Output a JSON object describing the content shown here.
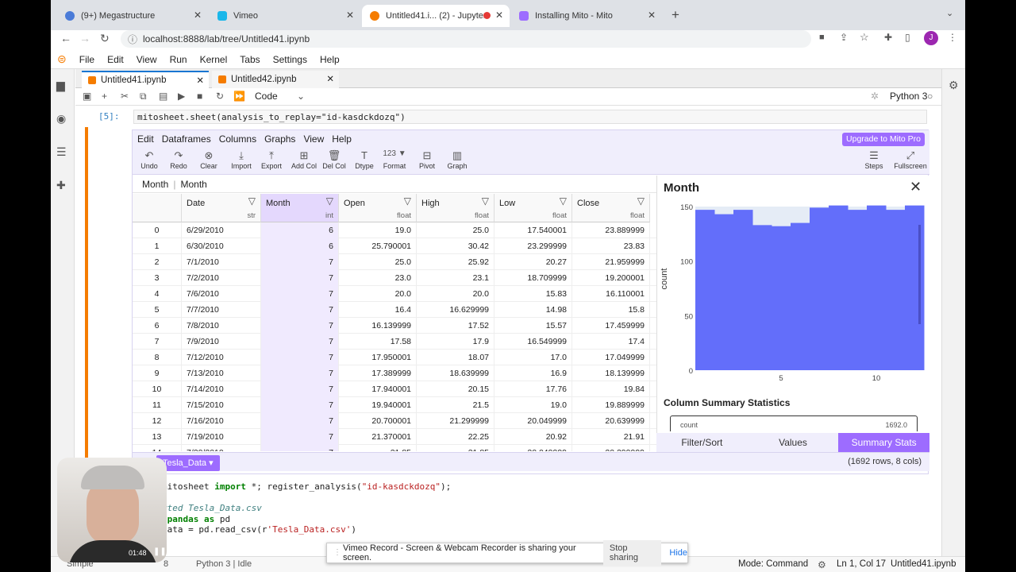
{
  "browser": {
    "tabs": [
      {
        "title": "(9+) Megastructure",
        "color": "#4a7bd8"
      },
      {
        "title": "Vimeo",
        "color": "#1ab7ea"
      },
      {
        "title": "Untitled41.i... (2) - Jupyter",
        "color": "#f57c00"
      },
      {
        "title": "Installing Mito - Mito",
        "color": "#9d6cff"
      }
    ],
    "url": "localhost:8888/lab/tree/Untitled41.ipynb",
    "avatar_letter": "J"
  },
  "jupyter": {
    "menu": [
      "File",
      "Edit",
      "View",
      "Run",
      "Kernel",
      "Tabs",
      "Settings",
      "Help"
    ],
    "doc_tabs": [
      "Untitled41.ipynb",
      "Untitled42.ipynb"
    ],
    "cell_type": "Code",
    "kernel": "Python 3",
    "prompt": "[5]:",
    "cell_code": "mitosheet.sheet(analysis_to_replay=\"id-kasdckdozq\")"
  },
  "mito": {
    "menu": [
      "Edit",
      "Dataframes",
      "Columns",
      "Graphs",
      "View",
      "Help"
    ],
    "upgrade": "Upgrade to Mito Pro",
    "tools": [
      "Undo",
      "Redo",
      "Clear",
      "Import",
      "Export",
      "Add Col",
      "Del Col",
      "Dtype",
      "Format",
      "Pivot",
      "Graph"
    ],
    "tools_right": [
      "Steps",
      "Fullscreen"
    ],
    "format_glyph": "123 ▼",
    "formula_col": "Month",
    "formula_value": "Month",
    "columns": [
      {
        "name": "Date",
        "type": "str"
      },
      {
        "name": "Month",
        "type": "int"
      },
      {
        "name": "Open",
        "type": "float"
      },
      {
        "name": "High",
        "type": "float"
      },
      {
        "name": "Low",
        "type": "float"
      },
      {
        "name": "Close",
        "type": "float"
      }
    ],
    "rows": [
      [
        "0",
        "6/29/2010",
        "6",
        "19.0",
        "25.0",
        "17.540001",
        "23.889999"
      ],
      [
        "1",
        "6/30/2010",
        "6",
        "25.790001",
        "30.42",
        "23.299999",
        "23.83"
      ],
      [
        "2",
        "7/1/2010",
        "7",
        "25.0",
        "25.92",
        "20.27",
        "21.959999"
      ],
      [
        "3",
        "7/2/2010",
        "7",
        "23.0",
        "23.1",
        "18.709999",
        "19.200001"
      ],
      [
        "4",
        "7/6/2010",
        "7",
        "20.0",
        "20.0",
        "15.83",
        "16.110001"
      ],
      [
        "5",
        "7/7/2010",
        "7",
        "16.4",
        "16.629999",
        "14.98",
        "15.8"
      ],
      [
        "6",
        "7/8/2010",
        "7",
        "16.139999",
        "17.52",
        "15.57",
        "17.459999"
      ],
      [
        "7",
        "7/9/2010",
        "7",
        "17.58",
        "17.9",
        "16.549999",
        "17.4"
      ],
      [
        "8",
        "7/12/2010",
        "7",
        "17.950001",
        "18.07",
        "17.0",
        "17.049999"
      ],
      [
        "9",
        "7/13/2010",
        "7",
        "17.389999",
        "18.639999",
        "16.9",
        "18.139999"
      ],
      [
        "10",
        "7/14/2010",
        "7",
        "17.940001",
        "20.15",
        "17.76",
        "19.84"
      ],
      [
        "11",
        "7/15/2010",
        "7",
        "19.940001",
        "21.5",
        "19.0",
        "19.889999"
      ],
      [
        "12",
        "7/16/2010",
        "7",
        "20.700001",
        "21.299999",
        "20.049999",
        "20.639999"
      ],
      [
        "13",
        "7/19/2010",
        "7",
        "21.370001",
        "22.25",
        "20.92",
        "21.91"
      ],
      [
        "14",
        "7/20/2010",
        "7",
        "21.85",
        "21.85",
        "20.049999",
        "20.299999"
      ]
    ],
    "sidebar": {
      "title": "Month",
      "summary_title": "Column Summary Statistics",
      "summary_first_row_label": "count",
      "summary_first_row_value": "1692.0",
      "tabs": [
        "Filter/Sort",
        "Values",
        "Summary Stats"
      ]
    },
    "sheet_tab": "Tesla_Data ▾",
    "row_info": "(1692 rows, 8 cols)"
  },
  "chart_data": {
    "type": "bar",
    "ylabel": "count",
    "xticks": [
      5,
      10
    ],
    "yticks": [
      0,
      50,
      100,
      150
    ],
    "ylim": [
      0,
      150
    ],
    "categories": [
      "1",
      "2",
      "3",
      "4",
      "5",
      "6",
      "7",
      "8",
      "9",
      "10",
      "11",
      "12"
    ],
    "values": [
      147,
      143,
      147,
      133,
      132,
      135,
      149,
      151,
      147,
      151,
      147,
      151
    ],
    "bar_color": "#636efa",
    "plot_bg": "#e5ecf6"
  },
  "code2": {
    "line1_a": "mitosheet ",
    "line1_kw": "import",
    "line1_b": " *; register_analysis(",
    "line1_str": "\"id-kasdckdozq\"",
    "line1_c": ");",
    "line2": "rted Tesla_Data.csv",
    "line3_kw": " pandas ",
    "line3_kw2": "as",
    "line3_b": " pd",
    "line4_a": "Data = pd.read_csv(r",
    "line4_str": "'Tesla_Data.csv'",
    "line4_b": ")"
  },
  "status": {
    "mode": "Mode: Command",
    "position": "Ln 1, Col 17",
    "file": "Untitled41.ipynb",
    "left_a": "Simple",
    "left_b": "8",
    "left_c": "Python 3 | Idle",
    "rec_time": "01:48"
  },
  "share": {
    "message": "Vimeo Record - Screen & Webcam Recorder is sharing your screen.",
    "stop": "Stop sharing",
    "hide": "Hide"
  }
}
